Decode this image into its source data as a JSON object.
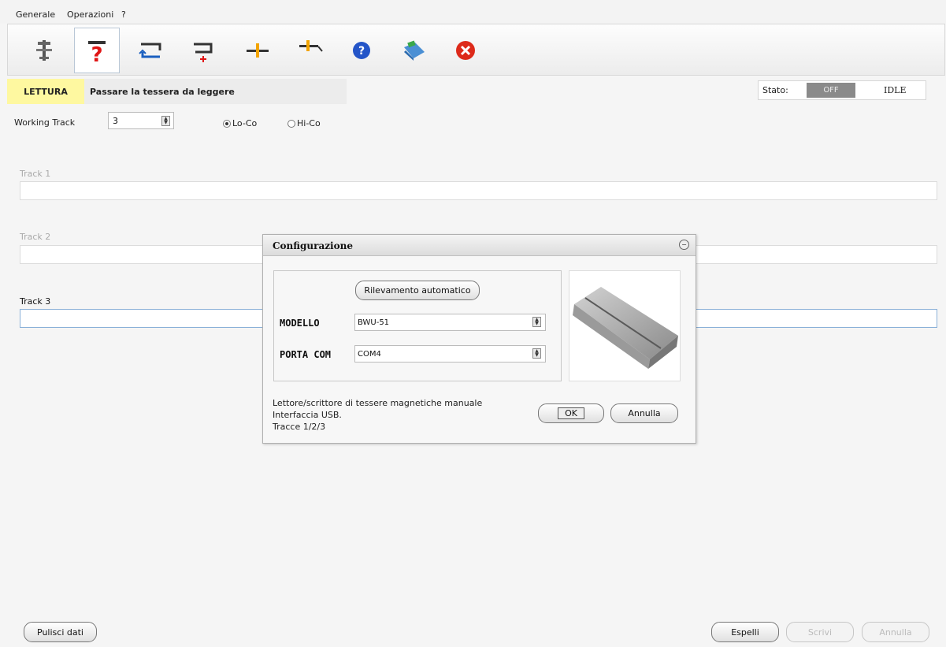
{
  "menu": [
    {
      "label": "Generale"
    },
    {
      "label": "Operazioni"
    },
    {
      "label": "?"
    }
  ],
  "toolbar": [
    {
      "name": "setup",
      "active": false
    },
    {
      "name": "read",
      "active": true
    },
    {
      "name": "copy",
      "active": false
    },
    {
      "name": "write",
      "active": false
    },
    {
      "name": "erase",
      "active": false
    },
    {
      "name": "format",
      "active": false
    },
    {
      "name": "help",
      "active": false
    },
    {
      "name": "book",
      "active": false
    },
    {
      "name": "exit",
      "active": false
    }
  ],
  "mode": {
    "badge": "LETTURA",
    "message": "Passare la tessera da leggere"
  },
  "status": {
    "label": "Stato:",
    "state": "OFF",
    "mode": "IDLE"
  },
  "working_track": {
    "label": "Working Track",
    "value": "3",
    "options": [
      "Lo-Co",
      "Hi-Co"
    ],
    "selected": "Lo-Co"
  },
  "tracks": [
    {
      "label": "Track 1",
      "value": ""
    },
    {
      "label": "Track 2",
      "value": ""
    },
    {
      "label": "Track 3",
      "value": ""
    }
  ],
  "dialog": {
    "title": "Configurazione",
    "auto_detect": "Rilevamento automatico",
    "model_label": "MODELLO",
    "model_value": "BWU-51",
    "port_label": "PORTA COM",
    "port_value": "COM4",
    "description": [
      "Lettore/scrittore di tessere magnetiche manuale",
      "Interfaccia USB.",
      "Tracce 1/2/3"
    ],
    "ok": "OK",
    "cancel": "Annulla"
  },
  "bottom": {
    "clear": "Pulisci dati",
    "eject": "Espelli",
    "write": "Scrivi",
    "cancel": "Annulla"
  },
  "colors": {
    "mode_badge": "#fef8a0",
    "status_off": "#8a8a8a"
  }
}
